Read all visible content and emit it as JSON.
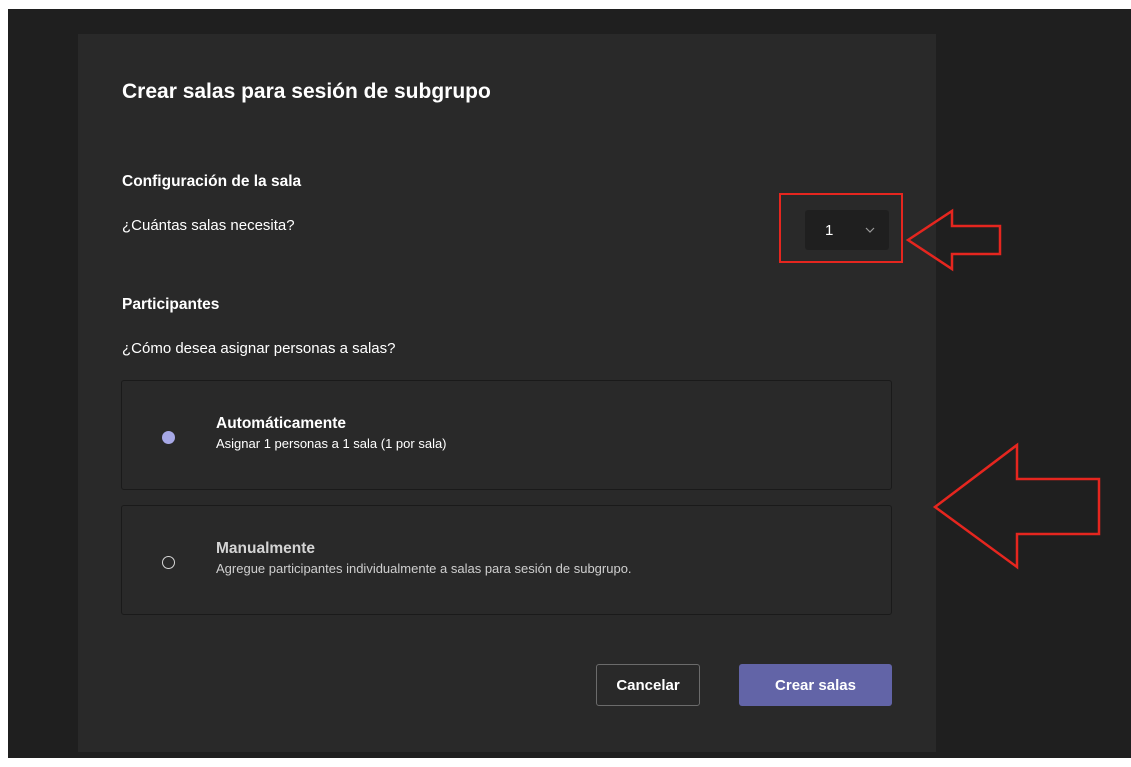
{
  "dialog": {
    "title": "Crear salas para sesión de subgrupo",
    "room_section": {
      "heading": "Configuración de la sala",
      "question": "¿Cuántas salas necesita?",
      "count_value": "1"
    },
    "participants_section": {
      "heading": "Participantes",
      "question": "¿Cómo desea asignar personas a salas?",
      "options": [
        {
          "title": "Automáticamente",
          "description": "Asignar 1 personas a 1 sala (1 por sala)",
          "selected": true
        },
        {
          "title": "Manualmente",
          "description": "Agregue participantes individualmente a salas para sesión de subgrupo.",
          "selected": false
        }
      ]
    },
    "buttons": {
      "cancel_label": "Cancelar",
      "create_label": "Crear salas"
    }
  },
  "colors": {
    "backdrop": "#1f1f1f",
    "dialog_bg": "#292929",
    "accent": "#6264a7",
    "radio_selected": "#a7a8e6",
    "annotation_red": "#e5261f"
  },
  "icons": [
    "chevron-down-icon",
    "radio-selected-icon",
    "radio-unselected-icon",
    "annotation-arrow-icon"
  ]
}
